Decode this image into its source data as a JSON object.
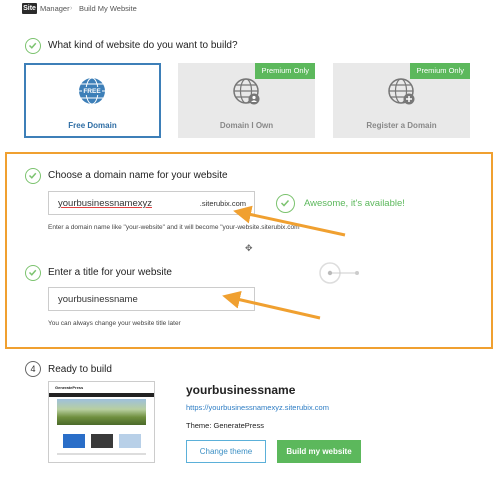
{
  "header": {
    "logo": "Site",
    "app_name": "Manager",
    "separator": "›",
    "page": "Build My Website"
  },
  "step1": {
    "question": "What kind of website do you want to build?",
    "cards": [
      {
        "label": "Free Domain",
        "icon_text": "FREE",
        "badge": ""
      },
      {
        "label": "Domain I Own",
        "badge": "Premium Only"
      },
      {
        "label": "Register a Domain",
        "badge": "Premium Only"
      }
    ]
  },
  "step2": {
    "question": "Choose a domain name for your website",
    "input_value": "yourbusinessnamexyz",
    "suffix": ".siterubix.com",
    "status": "Awesome, it's available!",
    "hint": "Enter a domain name like \"your-website\" and it will become \"your-website.siterubix.com\""
  },
  "step3": {
    "question": "Enter a title for your website",
    "input_value": "yourbusinessname",
    "hint": "You can always change your website title later"
  },
  "step4": {
    "number": "4",
    "question": "Ready to build",
    "site_title": "yourbusinessname",
    "site_url": "https://yourbusinessnamexyz.siterubix.com",
    "theme": "Theme: GeneratePress",
    "change_theme": "Change theme",
    "build": "Build my website",
    "preview_brand": "GeneratePress"
  },
  "colors": {
    "accent_green": "#5cb85c",
    "accent_blue": "#3d7fb8",
    "highlight_orange": "#f0a030"
  }
}
